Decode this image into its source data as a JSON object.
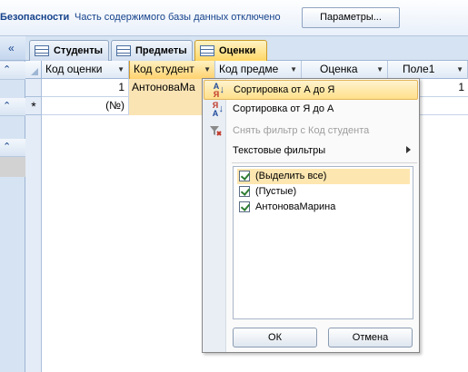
{
  "message_bar": {
    "title": "Безопасности",
    "text": "Часть содержимого базы данных отключено",
    "button_label": "Параметры..."
  },
  "nav": {
    "collapse_glyph": "«",
    "group_glyph": "⌃"
  },
  "tabs": [
    {
      "label": "Студенты",
      "active": false
    },
    {
      "label": "Предметы",
      "active": false
    },
    {
      "label": "Оценки",
      "active": true
    }
  ],
  "grid": {
    "columns": [
      "Код оценки",
      "Код студент",
      "Код предме",
      "Оценка",
      "Поле1"
    ],
    "rows": [
      {
        "code": "1",
        "student": "АнтоноваМа",
        "subject": "",
        "grade": "",
        "field1": "1"
      }
    ],
    "new_row": {
      "marker": "*",
      "code": "(№)"
    }
  },
  "menu": {
    "items": [
      {
        "label": "Сортировка от А до Я",
        "icon": "sort-ascending-icon",
        "state": "hover"
      },
      {
        "label": "Сортировка от Я до А",
        "icon": "sort-descending-icon",
        "state": "normal"
      },
      {
        "label": "Снять фильтр с Код студента",
        "icon": "clear-filter-icon",
        "state": "disabled"
      },
      {
        "label": "Текстовые фильтры",
        "icon": "",
        "state": "submenu"
      }
    ],
    "sort_icon_letters_up": {
      "top": "А",
      "bottom": "Я"
    },
    "sort_icon_letters_down": {
      "top": "Я",
      "bottom": "А"
    },
    "filter_values": [
      {
        "label": "(Выделить все)",
        "checked": true
      },
      {
        "label": "(Пустые)",
        "checked": true
      },
      {
        "label": "АнтоноваМарина",
        "checked": true
      }
    ],
    "ok_label": "ОК",
    "cancel_label": "Отмена"
  },
  "colors": {
    "accent": "#15428b",
    "active_tab": "#ffd766",
    "hover": "#ffe08a"
  }
}
